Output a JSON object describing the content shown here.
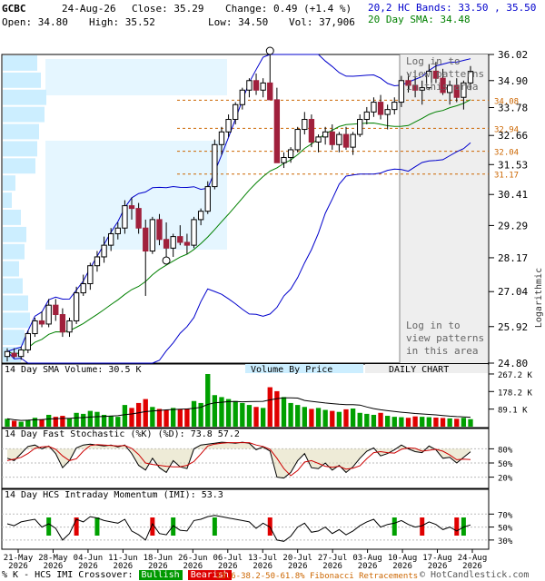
{
  "header": {
    "ticker": "GCBC",
    "date": "24-Aug-26",
    "close_label": "Close:",
    "close": "35.29",
    "change_label": "Change:",
    "change": "0.49 (+1.4 %)",
    "open_label": "Open:",
    "open": "34.80",
    "high_label": "High:",
    "high": "35.52",
    "low_label": "Low:",
    "low": "34.50",
    "vol_label": "Vol:",
    "vol": "37,906",
    "bands_label": "20,2 HC Bands: 33.50 , 35.50",
    "sma_label": "20 Day SMA: 34.48",
    "colors": {
      "bands": "#0000cc",
      "sma": "#008000"
    }
  },
  "price_panel": {
    "ylabel": "Logarithmic",
    "login_text_top": "Log in to view patterns in this area",
    "login_text_bottom": "Log in to view patterns in this area",
    "fib_labels": [
      "34.08",
      "32.94",
      "32.04",
      "31.17"
    ]
  },
  "volume_panel": {
    "sma_label": "14 Day SMA Volume: 30.5 K",
    "vbp_label": "Volume By Price",
    "daily_label": "DAILY CHART",
    "ticks": [
      "267.2 K",
      "178.2 K",
      "89.1 K"
    ]
  },
  "stoch_panel": {
    "label": "14 Day Fast Stochastic (%K) (%D): 73.8   57.2",
    "ticks": [
      "80%",
      "50%",
      "20%"
    ]
  },
  "imi_panel": {
    "label": "14 Day HCS Intraday Momentum (IMI): 53.3",
    "ticks": [
      "70%",
      "50%",
      "30%"
    ]
  },
  "x_axis": {
    "ticks": [
      "21-May\n2026",
      "28-May\n2026",
      "04-Jun\n2026",
      "11-Jun\n2026",
      "18-Jun\n2026",
      "26-Jun\n2026",
      "06-Jul\n2026",
      "13-Jul\n2026",
      "20-Jul\n2026",
      "27-Jul\n2026",
      "03-Aug\n2026",
      "10-Aug\n2026",
      "17-Aug\n2026",
      "24-Aug\n2026"
    ]
  },
  "footer": {
    "left_text": "% K - HCS IMI Crossover:",
    "bullish": "Bullish",
    "bearish": "Bearish",
    "fib_text": "23.6-38.2-50-61.8% Fibonacci Retracements",
    "copyright": "© HotCandlestick.com",
    "colors": {
      "bullish": "#009900",
      "bearish": "#dd0000",
      "fib": "#cc6600"
    }
  },
  "chart_data": {
    "type": "candlestick",
    "scale": "log",
    "y_ticks": [
      36.02,
      34.9,
      33.78,
      32.66,
      31.53,
      30.41,
      29.29,
      28.17,
      27.04,
      25.92,
      24.8
    ],
    "ylim": [
      24.8,
      36.02
    ],
    "candles": [
      [
        25.0,
        25.25,
        24.85,
        25.15
      ],
      [
        25.1,
        25.25,
        24.95,
        25.0
      ],
      [
        25.0,
        25.3,
        24.9,
        25.2
      ],
      [
        25.2,
        25.8,
        25.1,
        25.7
      ],
      [
        25.7,
        26.2,
        25.6,
        26.1
      ],
      [
        26.1,
        26.4,
        25.9,
        26.0
      ],
      [
        26.0,
        26.8,
        25.9,
        26.6
      ],
      [
        26.6,
        26.8,
        26.1,
        26.3
      ],
      [
        26.3,
        26.5,
        25.6,
        25.75
      ],
      [
        25.75,
        26.2,
        25.6,
        26.1
      ],
      [
        26.1,
        27.2,
        26.0,
        27.0
      ],
      [
        27.0,
        27.6,
        26.9,
        27.3
      ],
      [
        27.3,
        28.0,
        27.1,
        27.9
      ],
      [
        27.9,
        28.4,
        27.7,
        28.2
      ],
      [
        28.2,
        28.9,
        28.0,
        28.6
      ],
      [
        28.6,
        29.2,
        28.4,
        29.0
      ],
      [
        29.0,
        29.4,
        28.8,
        29.2
      ],
      [
        29.2,
        30.2,
        29.0,
        30.0
      ],
      [
        30.0,
        30.3,
        29.5,
        29.9
      ],
      [
        29.9,
        30.1,
        29.0,
        29.2
      ],
      [
        29.2,
        29.5,
        26.9,
        28.4
      ],
      [
        28.4,
        29.6,
        28.3,
        29.5
      ],
      [
        29.5,
        29.7,
        28.6,
        28.8
      ],
      [
        28.8,
        29.4,
        28.2,
        28.5
      ],
      [
        28.5,
        29.0,
        28.2,
        28.9
      ],
      [
        28.9,
        29.3,
        28.6,
        28.7
      ],
      [
        28.7,
        29.0,
        28.3,
        28.6
      ],
      [
        28.6,
        29.6,
        28.5,
        29.5
      ],
      [
        29.5,
        29.9,
        29.3,
        29.8
      ],
      [
        29.8,
        30.9,
        29.7,
        30.7
      ],
      [
        30.7,
        32.5,
        30.6,
        32.3
      ],
      [
        32.3,
        33.0,
        31.9,
        32.8
      ],
      [
        32.8,
        33.5,
        32.6,
        33.3
      ],
      [
        33.3,
        34.0,
        33.1,
        33.9
      ],
      [
        33.9,
        34.6,
        33.7,
        34.5
      ],
      [
        34.5,
        35.0,
        34.2,
        34.9
      ],
      [
        34.9,
        35.2,
        34.3,
        34.5
      ],
      [
        34.5,
        35.0,
        34.2,
        34.8
      ],
      [
        34.8,
        36.02,
        34.5,
        34.1
      ],
      [
        34.1,
        34.6,
        33.3,
        31.6
      ],
      [
        31.6,
        32.0,
        31.4,
        31.8
      ],
      [
        31.8,
        32.2,
        31.6,
        32.1
      ],
      [
        32.1,
        33.0,
        32.0,
        32.9
      ],
      [
        32.9,
        33.6,
        32.7,
        33.3
      ],
      [
        33.3,
        33.5,
        32.2,
        32.4
      ],
      [
        32.4,
        32.7,
        32.0,
        32.6
      ],
      [
        32.6,
        33.0,
        32.3,
        32.8
      ],
      [
        32.8,
        33.1,
        32.1,
        32.3
      ],
      [
        32.3,
        32.8,
        32.0,
        32.7
      ],
      [
        32.7,
        33.0,
        32.1,
        32.2
      ],
      [
        32.2,
        32.8,
        31.9,
        32.7
      ],
      [
        32.7,
        33.5,
        32.6,
        33.3
      ],
      [
        33.3,
        33.8,
        33.1,
        33.6
      ],
      [
        33.6,
        34.2,
        33.4,
        34.0
      ],
      [
        34.0,
        34.3,
        33.3,
        33.5
      ],
      [
        33.5,
        33.9,
        32.9,
        33.7
      ],
      [
        33.7,
        34.2,
        33.5,
        34.0
      ],
      [
        34.0,
        35.1,
        33.8,
        34.9
      ],
      [
        34.9,
        35.2,
        34.4,
        34.7
      ],
      [
        34.7,
        35.3,
        34.2,
        34.5
      ],
      [
        34.5,
        34.9,
        33.9,
        34.6
      ],
      [
        34.6,
        35.6,
        34.5,
        35.3
      ],
      [
        35.3,
        35.7,
        34.8,
        35.0
      ],
      [
        35.0,
        35.4,
        34.3,
        34.4
      ],
      [
        34.4,
        34.9,
        33.9,
        34.7
      ],
      [
        34.7,
        35.0,
        34.0,
        34.2
      ],
      [
        34.2,
        34.9,
        33.7,
        34.8
      ],
      [
        34.8,
        35.52,
        34.5,
        35.29
      ]
    ],
    "volume": [
      40,
      30,
      25,
      35,
      45,
      38,
      60,
      50,
      55,
      42,
      70,
      65,
      80,
      75,
      60,
      55,
      50,
      110,
      95,
      120,
      140,
      100,
      90,
      85,
      95,
      88,
      92,
      130,
      120,
      267,
      160,
      150,
      140,
      130,
      120,
      110,
      100,
      95,
      200,
      180,
      150,
      120,
      110,
      100,
      90,
      95,
      85,
      80,
      75,
      88,
      92,
      70,
      65,
      60,
      70,
      55,
      50,
      48,
      45,
      52,
      50,
      48,
      46,
      44,
      42,
      40,
      45,
      38
    ],
    "vol_bull": [
      1,
      0,
      1,
      1,
      1,
      0,
      1,
      0,
      0,
      1,
      1,
      1,
      1,
      1,
      1,
      1,
      1,
      1,
      0,
      0,
      0,
      1,
      0,
      0,
      1,
      0,
      0,
      1,
      1,
      1,
      1,
      1,
      1,
      1,
      1,
      1,
      0,
      1,
      0,
      0,
      1,
      1,
      1,
      1,
      0,
      1,
      1,
      0,
      1,
      0,
      1,
      1,
      1,
      1,
      0,
      1,
      1,
      1,
      0,
      0,
      1,
      1,
      0,
      0,
      1,
      0,
      1,
      1
    ],
    "stoch_k": [
      60,
      55,
      70,
      85,
      88,
      80,
      86,
      70,
      40,
      55,
      82,
      88,
      90,
      88,
      86,
      88,
      84,
      88,
      70,
      45,
      35,
      60,
      40,
      30,
      55,
      42,
      38,
      80,
      88,
      90,
      92,
      94,
      93,
      92,
      94,
      92,
      78,
      84,
      75,
      20,
      18,
      30,
      55,
      70,
      40,
      38,
      50,
      35,
      45,
      30,
      42,
      60,
      75,
      82,
      65,
      70,
      78,
      88,
      80,
      74,
      72,
      86,
      78,
      60,
      62,
      50,
      62,
      73.8
    ],
    "stoch_d": [
      55,
      58,
      62,
      70,
      81,
      84,
      85,
      79,
      65,
      55,
      59,
      75,
      87,
      89,
      88,
      87,
      86,
      87,
      81,
      68,
      50,
      47,
      45,
      43,
      42,
      42,
      45,
      53,
      69,
      86,
      90,
      92,
      93,
      93,
      93,
      93,
      88,
      85,
      79,
      60,
      38,
      23,
      34,
      52,
      55,
      49,
      43,
      41,
      43,
      37,
      39,
      44,
      59,
      72,
      74,
      72,
      71,
      79,
      82,
      81,
      75,
      77,
      79,
      75,
      67,
      57,
      58,
      57.2
    ],
    "imi": [
      55,
      52,
      58,
      60,
      62,
      50,
      55,
      48,
      30,
      40,
      62,
      58,
      66,
      64,
      60,
      58,
      56,
      62,
      44,
      38,
      30,
      55,
      40,
      38,
      52,
      45,
      44,
      60,
      62,
      66,
      68,
      66,
      64,
      62,
      60,
      58,
      48,
      56,
      50,
      30,
      28,
      36,
      50,
      56,
      42,
      44,
      50,
      40,
      46,
      38,
      44,
      52,
      58,
      62,
      50,
      54,
      56,
      60,
      54,
      50,
      52,
      58,
      54,
      46,
      50,
      44,
      50,
      53.3
    ]
  }
}
